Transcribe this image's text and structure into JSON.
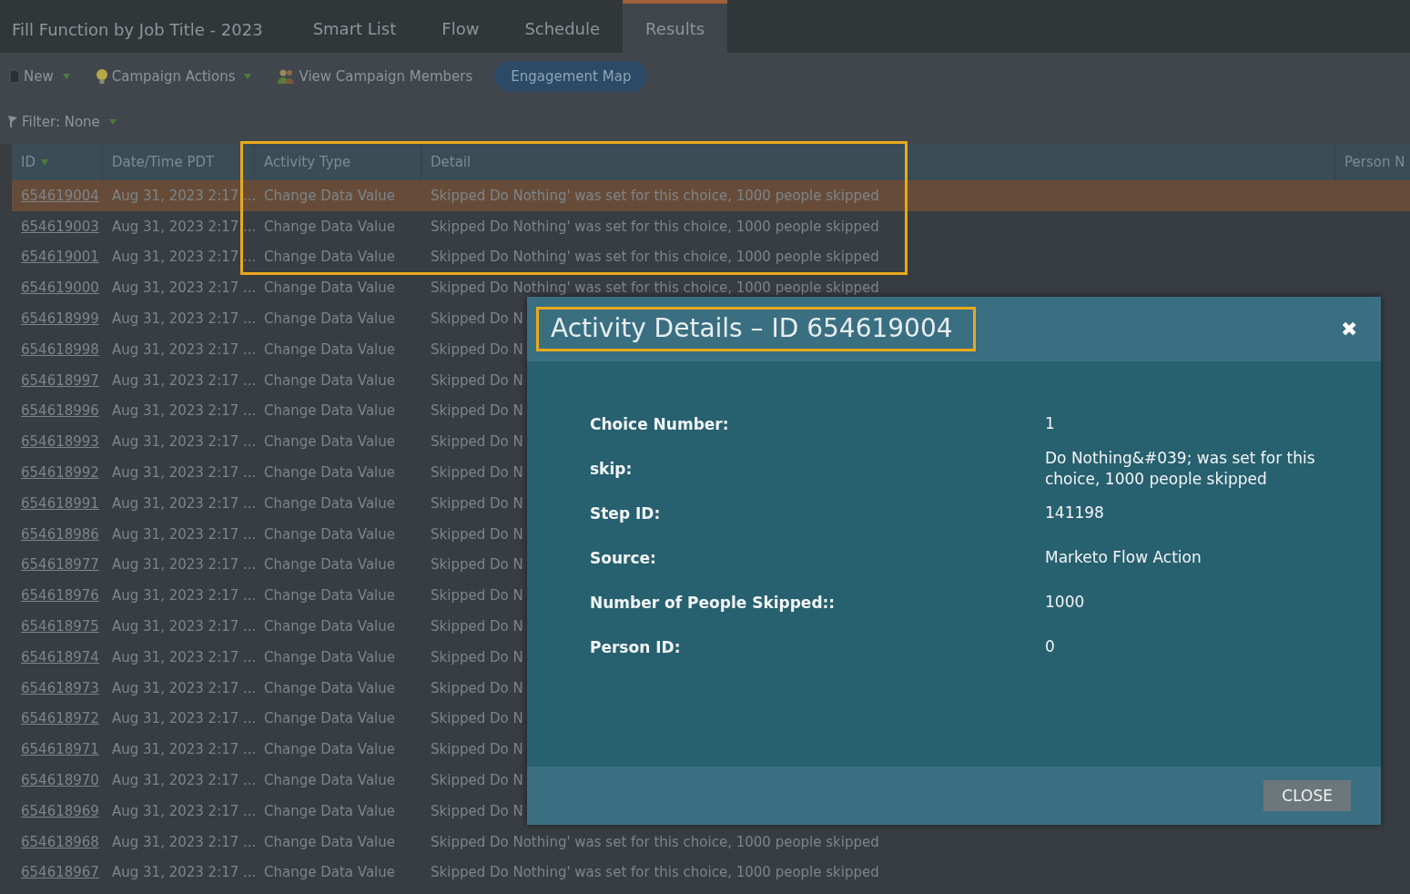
{
  "program_title": "Fill Function by Job Title - 2023",
  "tabs": [
    {
      "label": "Smart List",
      "selected": false
    },
    {
      "label": "Flow",
      "selected": false
    },
    {
      "label": "Schedule",
      "selected": false
    },
    {
      "label": "Results",
      "selected": true
    }
  ],
  "toolbar": [
    {
      "label": "New",
      "kind": "menu"
    },
    {
      "label": "Campaign Actions",
      "kind": "menu"
    },
    {
      "label": "View Campaign Members",
      "kind": "plain"
    },
    {
      "label": "Engagement Map",
      "kind": "pill"
    }
  ],
  "filter": {
    "label": "Filter: None"
  },
  "table": {
    "columns": [
      "ID",
      "Date/Time PDT",
      "Activity Type",
      "Detail",
      "Person N"
    ],
    "rows": [
      {
        "id": "654619004",
        "date": "Aug 31, 2023 2:17 ...",
        "type": "Change Data Value",
        "detail": "Skipped Do Nothing' was set for this choice, 1000 people skipped",
        "selected": true
      },
      {
        "id": "654619003",
        "date": "Aug 31, 2023 2:17 ...",
        "type": "Change Data Value",
        "detail": "Skipped Do Nothing' was set for this choice, 1000 people skipped",
        "selected": false
      },
      {
        "id": "654619001",
        "date": "Aug 31, 2023 2:17 ...",
        "type": "Change Data Value",
        "detail": "Skipped Do Nothing' was set for this choice, 1000 people skipped",
        "selected": false
      },
      {
        "id": "654619000",
        "date": "Aug 31, 2023 2:17 ...",
        "type": "Change Data Value",
        "detail": "Skipped Do Nothing' was set for this choice, 1000 people skipped",
        "selected": false
      },
      {
        "id": "654618999",
        "date": "Aug 31, 2023 2:17 ...",
        "type": "Change Data Value",
        "detail": "Skipped Do N",
        "selected": false
      },
      {
        "id": "654618998",
        "date": "Aug 31, 2023 2:17 ...",
        "type": "Change Data Value",
        "detail": "Skipped Do N",
        "selected": false
      },
      {
        "id": "654618997",
        "date": "Aug 31, 2023 2:17 ...",
        "type": "Change Data Value",
        "detail": "Skipped Do N",
        "selected": false
      },
      {
        "id": "654618996",
        "date": "Aug 31, 2023 2:17 ...",
        "type": "Change Data Value",
        "detail": "Skipped Do N",
        "selected": false
      },
      {
        "id": "654618993",
        "date": "Aug 31, 2023 2:17 ...",
        "type": "Change Data Value",
        "detail": "Skipped Do N",
        "selected": false
      },
      {
        "id": "654618992",
        "date": "Aug 31, 2023 2:17 ...",
        "type": "Change Data Value",
        "detail": "Skipped Do N",
        "selected": false
      },
      {
        "id": "654618991",
        "date": "Aug 31, 2023 2:17 ...",
        "type": "Change Data Value",
        "detail": "Skipped Do N",
        "selected": false
      },
      {
        "id": "654618986",
        "date": "Aug 31, 2023 2:17 ...",
        "type": "Change Data Value",
        "detail": "Skipped Do N",
        "selected": false
      },
      {
        "id": "654618977",
        "date": "Aug 31, 2023 2:17 ...",
        "type": "Change Data Value",
        "detail": "Skipped Do N",
        "selected": false
      },
      {
        "id": "654618976",
        "date": "Aug 31, 2023 2:17 ...",
        "type": "Change Data Value",
        "detail": "Skipped Do N",
        "selected": false
      },
      {
        "id": "654618975",
        "date": "Aug 31, 2023 2:17 ...",
        "type": "Change Data Value",
        "detail": "Skipped Do N",
        "selected": false
      },
      {
        "id": "654618974",
        "date": "Aug 31, 2023 2:17 ...",
        "type": "Change Data Value",
        "detail": "Skipped Do N",
        "selected": false
      },
      {
        "id": "654618973",
        "date": "Aug 31, 2023 2:17 ...",
        "type": "Change Data Value",
        "detail": "Skipped Do N",
        "selected": false
      },
      {
        "id": "654618972",
        "date": "Aug 31, 2023 2:17 ...",
        "type": "Change Data Value",
        "detail": "Skipped Do N",
        "selected": false
      },
      {
        "id": "654618971",
        "date": "Aug 31, 2023 2:17 ...",
        "type": "Change Data Value",
        "detail": "Skipped Do N",
        "selected": false
      },
      {
        "id": "654618970",
        "date": "Aug 31, 2023 2:17 ...",
        "type": "Change Data Value",
        "detail": "Skipped Do N",
        "selected": false
      },
      {
        "id": "654618969",
        "date": "Aug 31, 2023 2:17 ...",
        "type": "Change Data Value",
        "detail": "Skipped Do N",
        "selected": false
      },
      {
        "id": "654618968",
        "date": "Aug 31, 2023 2:17 ...",
        "type": "Change Data Value",
        "detail": "Skipped Do Nothing' was set for this choice, 1000 people skipped",
        "selected": false
      },
      {
        "id": "654618967",
        "date": "Aug 31, 2023 2:17 ...",
        "type": "Change Data Value",
        "detail": "Skipped Do Nothing' was set for this choice, 1000 people skipped",
        "selected": false
      }
    ]
  },
  "dialog": {
    "title": "Activity Details – ID 654619004",
    "close_icon": "✖",
    "fields": [
      {
        "label": "Choice Number:",
        "value": "1"
      },
      {
        "label": "skip:",
        "value": "Do Nothing&#039; was set for this choice, 1000 people skipped"
      },
      {
        "label": "Step ID:",
        "value": "141198"
      },
      {
        "label": "Source:",
        "value": "Marketo Flow Action"
      },
      {
        "label": "Number of People Skipped::",
        "value": "1000"
      },
      {
        "label": "Person ID:",
        "value": "0"
      }
    ],
    "button": "CLOSE"
  }
}
